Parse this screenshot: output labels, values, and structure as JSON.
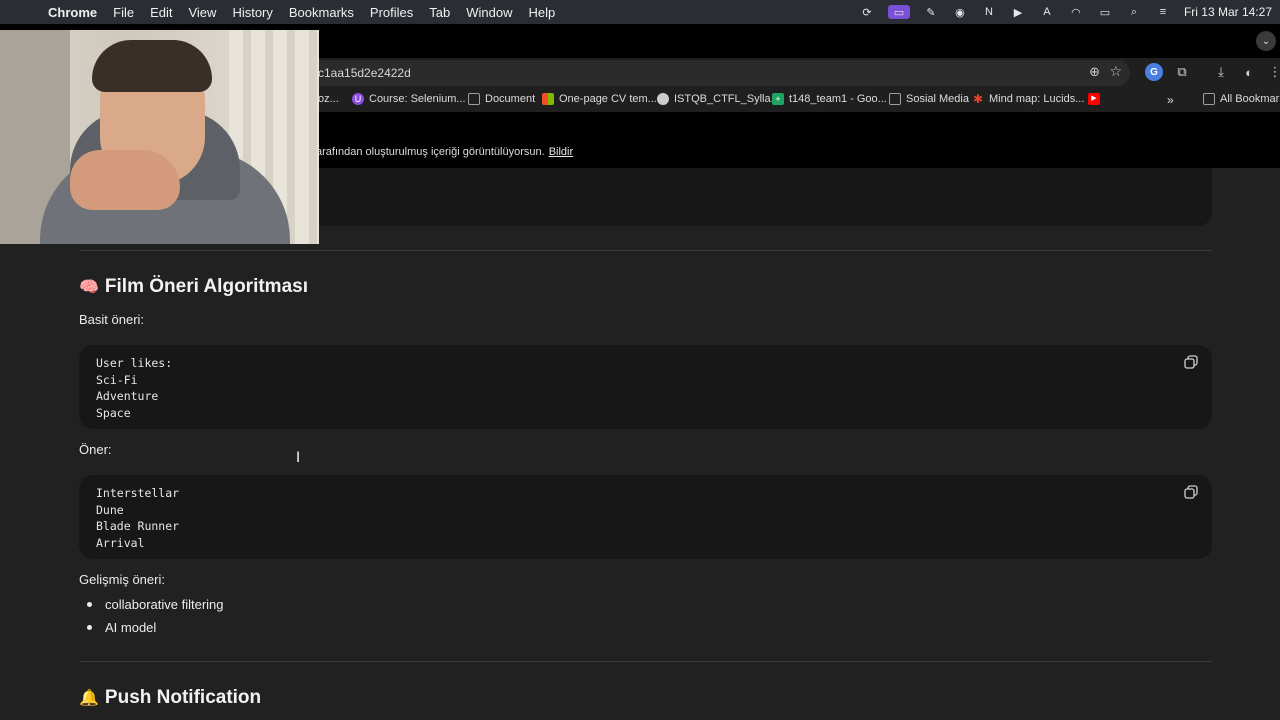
{
  "menubar": {
    "app": "Chrome",
    "items": [
      "File",
      "Edit",
      "View",
      "History",
      "Bookmarks",
      "Profiles",
      "Tab",
      "Window",
      "Help"
    ],
    "clock": "Fri 13 Mar 14:27"
  },
  "toolbar": {
    "url": "c1aa15d2e2422d"
  },
  "bookmarks": {
    "items": [
      {
        "label": "oz...",
        "icon": "page-icon",
        "color": "#888888"
      },
      {
        "label": "Course: Selenium...",
        "icon": "udemy-icon",
        "color": "#8a4fe0"
      },
      {
        "label": "Document",
        "icon": "folder-icon",
        "color": "#9aa0a6"
      },
      {
        "label": "One-page CV tem...",
        "icon": "microsoft-icon",
        "color": "#f25022"
      },
      {
        "label": "ISTQB_CTFL_Sylla...",
        "icon": "globe-icon",
        "color": "#cccccc"
      },
      {
        "label": "t148_team1 - Goo...",
        "icon": "sheets-icon",
        "color": "#1ea362"
      },
      {
        "label": "Sosial Media",
        "icon": "folder-icon",
        "color": "#9aa0a6"
      },
      {
        "label": "Mind map: Lucids...",
        "icon": "lucid-icon",
        "color": "#e0442f"
      },
      {
        "label": "",
        "icon": "youtube-icon",
        "color": "#ff0000"
      }
    ],
    "all_bookmarks": "All Bookmarks"
  },
  "infobar": {
    "message": "arafından oluşturulmuş içeriği görüntülüyorsun.",
    "report": "Bildir"
  },
  "content": {
    "section1": {
      "emoji": "🧠",
      "title": "Film Öneri Algoritması",
      "intro": "Basit öneri:",
      "code1": [
        "User likes:",
        "Sci-Fi",
        "Adventure",
        "Space"
      ],
      "recommend_label": "Öner:",
      "code2": [
        "Interstellar",
        "Dune",
        "Blade Runner",
        "Arrival"
      ],
      "advanced_label": "Gelişmiş öneri:",
      "bullets": [
        "collaborative filtering",
        "AI model"
      ]
    },
    "section2": {
      "emoji": "🔔",
      "title": "Push Notification"
    }
  },
  "colors": {
    "page_bg": "#212121",
    "code_bg": "#171717",
    "text": "#ececec"
  }
}
